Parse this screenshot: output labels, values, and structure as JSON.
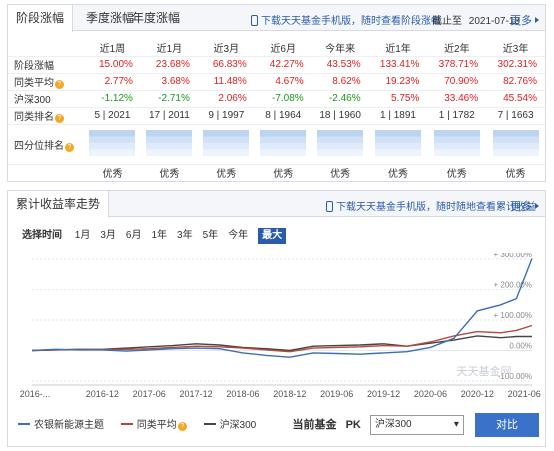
{
  "performance": {
    "tabs": [
      "阶段涨幅",
      "季度涨幅",
      "年度涨幅"
    ],
    "download_link": "下载天天基金手机版，随时查看阶段涨幅",
    "as_of_label": "截止至",
    "as_of_date": "2021-07-13",
    "more_label": "更多",
    "columns": [
      "近1周",
      "近1月",
      "近3月",
      "近6月",
      "今年来",
      "近1年",
      "近2年",
      "近3年"
    ],
    "rows": [
      {
        "label": "阶段涨幅",
        "help": false,
        "values": [
          "15.00%",
          "23.68%",
          "66.83%",
          "42.27%",
          "43.53%",
          "133.41%",
          "378.71%",
          "302.31%"
        ],
        "colors": [
          "red",
          "red",
          "red",
          "red",
          "red",
          "red",
          "red",
          "red"
        ]
      },
      {
        "label": "同类平均",
        "help": true,
        "values": [
          "2.77%",
          "3.68%",
          "11.48%",
          "4.67%",
          "8.62%",
          "19.23%",
          "70.90%",
          "82.76%"
        ],
        "colors": [
          "red",
          "red",
          "red",
          "red",
          "red",
          "red",
          "red",
          "red"
        ]
      },
      {
        "label": "沪深300",
        "help": false,
        "values": [
          "-1.12%",
          "-2.71%",
          "2.06%",
          "-7.08%",
          "-2.46%",
          "5.75%",
          "33.46%",
          "45.54%"
        ],
        "colors": [
          "green",
          "green",
          "red",
          "green",
          "green",
          "red",
          "red",
          "red"
        ]
      }
    ],
    "rank_label": "同类排名",
    "ranks": [
      "5 | 2021",
      "17 | 2011",
      "9 | 1997",
      "8 | 1964",
      "18 | 1960",
      "1 | 1891",
      "1 | 1782",
      "7 | 1663"
    ],
    "quartile_label": "四分位排名",
    "quartile_level": 1,
    "quartiles": [
      "优秀",
      "优秀",
      "优秀",
      "优秀",
      "优秀",
      "优秀",
      "优秀",
      "优秀"
    ]
  },
  "cumulative": {
    "title": "累计收益率走势",
    "download_link": "下载天天基金手机版，随时随地查看累计收益",
    "more_label": "更多",
    "range_label": "选择时间",
    "ranges": [
      "1月",
      "3月",
      "6月",
      "1年",
      "3年",
      "5年",
      "今年",
      "最大"
    ],
    "active_range": "最大",
    "watermark": "天天基金网",
    "legend": [
      "农银新能源主题",
      "同类平均",
      "沪深300"
    ],
    "compare_label": "当前基金",
    "pk_label": "PK",
    "compare_selected": "沪深300",
    "compare_button": "对比"
  },
  "chart_data": {
    "type": "line",
    "x_ticks": [
      "2016-...",
      "2016-12",
      "2017-06",
      "2017-12",
      "2018-06",
      "2018-12",
      "2019-06",
      "2019-12",
      "2020-06",
      "2020-12",
      "2021-06"
    ],
    "y_ticks": [
      "+ 300.00%",
      "+ 200.00%",
      "+ 100.00%",
      "0.00%",
      "-100.00%"
    ],
    "ylim": [
      -100,
      300
    ],
    "colors": {
      "fund": "#3a6fb5",
      "category_avg": "#b5493a",
      "hs300": "#444444"
    },
    "series": [
      {
        "name": "农银新能源主题",
        "x": [
          "2016-03",
          "2016-06",
          "2016-09",
          "2016-12",
          "2017-03",
          "2017-06",
          "2017-09",
          "2017-12",
          "2018-03",
          "2018-06",
          "2018-09",
          "2018-12",
          "2019-03",
          "2019-06",
          "2019-09",
          "2019-12",
          "2020-03",
          "2020-06",
          "2020-09",
          "2020-12",
          "2021-03",
          "2021-05",
          "2021-07"
        ],
        "values": [
          0,
          4,
          2,
          2,
          -2,
          2,
          6,
          8,
          6,
          -8,
          -16,
          -22,
          -8,
          -10,
          -12,
          -8,
          -4,
          10,
          40,
          130,
          150,
          170,
          302
        ]
      },
      {
        "name": "同类平均",
        "x": [
          "2016-03",
          "2016-06",
          "2016-09",
          "2016-12",
          "2017-03",
          "2017-06",
          "2017-09",
          "2017-12",
          "2018-03",
          "2018-06",
          "2018-09",
          "2018-12",
          "2019-03",
          "2019-06",
          "2019-09",
          "2019-12",
          "2020-03",
          "2020-06",
          "2020-09",
          "2020-12",
          "2021-03",
          "2021-05",
          "2021-07"
        ],
        "values": [
          0,
          2,
          4,
          3,
          4,
          6,
          10,
          14,
          12,
          8,
          2,
          -4,
          8,
          10,
          12,
          16,
          14,
          28,
          48,
          62,
          58,
          66,
          82
        ]
      },
      {
        "name": "沪深300",
        "x": [
          "2016-03",
          "2016-06",
          "2016-09",
          "2016-12",
          "2017-03",
          "2017-06",
          "2017-09",
          "2017-12",
          "2018-03",
          "2018-06",
          "2018-09",
          "2018-12",
          "2019-03",
          "2019-06",
          "2019-09",
          "2019-12",
          "2020-03",
          "2020-06",
          "2020-09",
          "2020-12",
          "2021-03",
          "2021-05",
          "2021-07"
        ],
        "values": [
          0,
          2,
          4,
          4,
          8,
          12,
          16,
          22,
          18,
          10,
          6,
          0,
          14,
          16,
          18,
          22,
          14,
          24,
          34,
          48,
          42,
          46,
          46
        ]
      }
    ]
  }
}
